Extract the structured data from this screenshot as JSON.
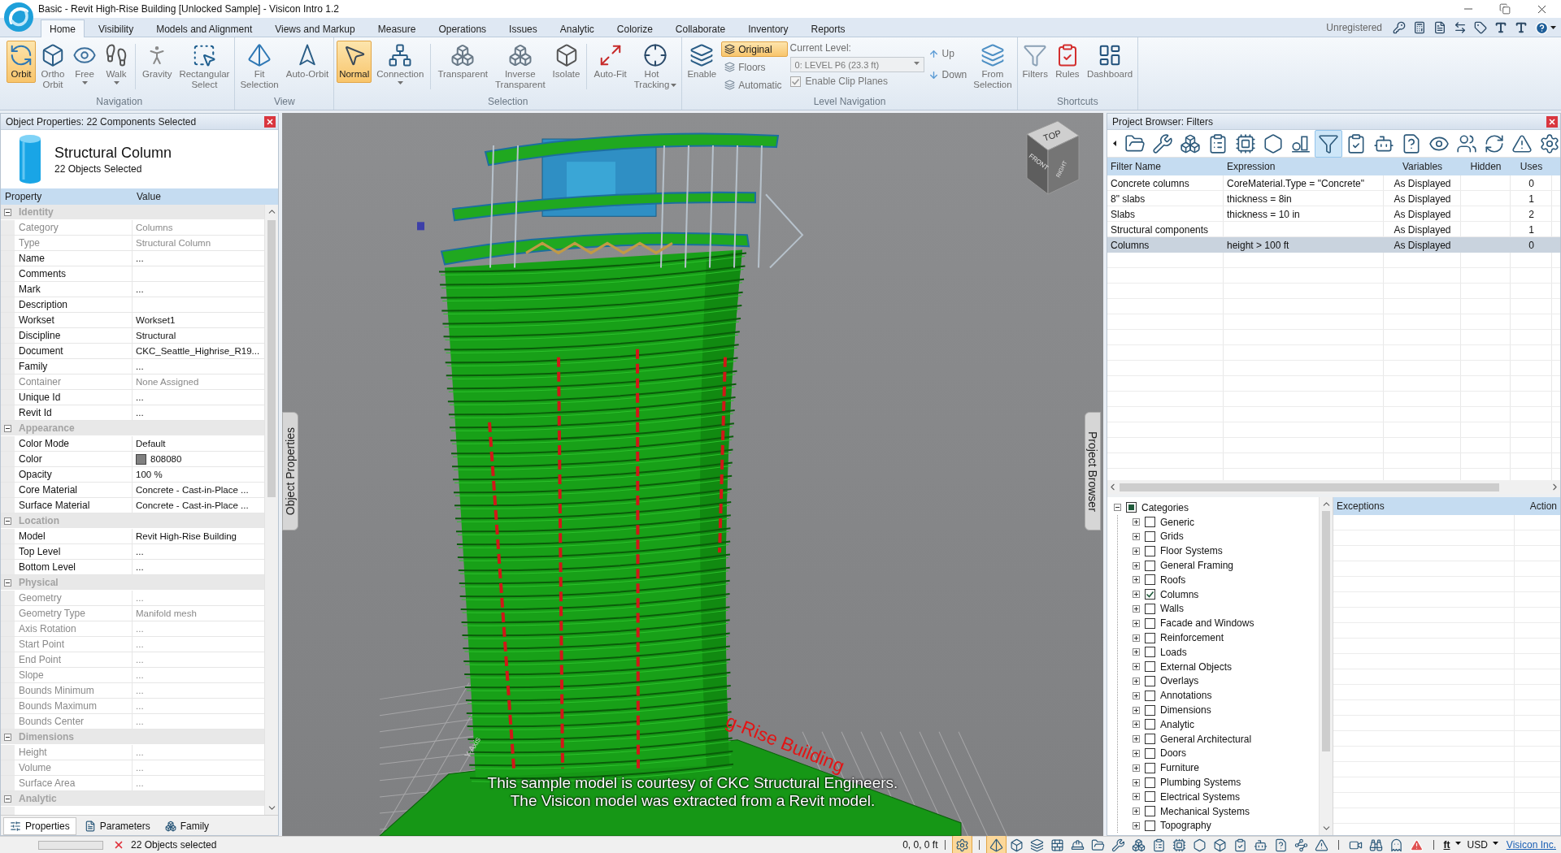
{
  "window": {
    "title": "Basic - Revit High-Rise Building [Unlocked Sample] - Visicon Intro 1.2"
  },
  "ribbon_tabs": [
    {
      "label": "Home",
      "selected": true
    },
    {
      "label": "Visibility",
      "selected": false
    },
    {
      "label": "Models and Alignment",
      "selected": false
    },
    {
      "label": "Views and Markup",
      "selected": false
    },
    {
      "label": "Measure",
      "selected": false
    },
    {
      "label": "Operations",
      "selected": false
    },
    {
      "label": "Issues",
      "selected": false
    },
    {
      "label": "Analytic",
      "selected": false
    },
    {
      "label": "Colorize",
      "selected": false
    },
    {
      "label": "Collaborate",
      "selected": false
    },
    {
      "label": "Inventory",
      "selected": false
    },
    {
      "label": "Reports",
      "selected": false
    }
  ],
  "account": {
    "status": "Unregistered"
  },
  "ribbon_groups": [
    {
      "label": "Navigation",
      "items": [
        {
          "kind": "large",
          "label": "Orbit",
          "selected": true,
          "dropdown": false
        },
        {
          "kind": "large",
          "label": "Ortho Orbit",
          "selected": false,
          "dropdown": false
        },
        {
          "kind": "large",
          "label": "Free",
          "selected": false,
          "dropdown": true
        },
        {
          "kind": "large",
          "label": "Walk",
          "selected": false,
          "dropdown": true
        },
        {
          "kind": "separator"
        },
        {
          "kind": "large",
          "label": "Gravity",
          "selected": false,
          "dropdown": false
        },
        {
          "kind": "large",
          "label": "Rectangular Select",
          "selected": false,
          "dropdown": false
        }
      ]
    },
    {
      "label": "View",
      "items": [
        {
          "kind": "large",
          "label": "Fit Selection",
          "selected": false,
          "dropdown": false
        },
        {
          "kind": "large",
          "label": "Auto-Orbit",
          "selected": false,
          "dropdown": false
        }
      ]
    },
    {
      "label": "Selection",
      "items": [
        {
          "kind": "large",
          "label": "Normal",
          "selected": true,
          "dropdown": false
        },
        {
          "kind": "large",
          "label": "Connection",
          "selected": false,
          "dropdown": true
        },
        {
          "kind": "separator"
        },
        {
          "kind": "large",
          "label": "Transparent",
          "selected": false,
          "dropdown": false
        },
        {
          "kind": "large",
          "label": "Inverse Transparent",
          "selected": false,
          "dropdown": false
        },
        {
          "kind": "large",
          "label": "Isolate",
          "selected": false,
          "dropdown": false
        },
        {
          "kind": "separator"
        },
        {
          "kind": "large",
          "label": "Auto-Fit",
          "selected": false,
          "dropdown": false
        },
        {
          "kind": "large",
          "label": "Hot Tracking",
          "selected": false,
          "dropdown": true
        }
      ]
    },
    {
      "label": "Level Navigation",
      "items": [
        {
          "kind": "large",
          "label": "Enable",
          "selected": false,
          "dropdown": false
        },
        {
          "kind": "mode_list",
          "options": [
            {
              "label": "Original",
              "selected": true
            },
            {
              "label": "Floors",
              "selected": false
            },
            {
              "label": "Automatic",
              "selected": false
            }
          ]
        },
        {
          "kind": "level_picker",
          "label": "Current Level:",
          "value": "0: LEVEL P6 (23.3 ft)",
          "disabled": true,
          "clip_planes": {
            "label": "Enable Clip Planes",
            "checked": true,
            "disabled": true
          }
        },
        {
          "kind": "step_list",
          "options": [
            {
              "label": "Up"
            },
            {
              "label": "Down"
            }
          ]
        },
        {
          "kind": "large",
          "label": "From Selection",
          "selected": false,
          "dropdown": false
        }
      ]
    },
    {
      "label": "Shortcuts",
      "items": [
        {
          "kind": "large",
          "label": "Filters",
          "selected": false,
          "dropdown": false
        },
        {
          "kind": "large",
          "label": "Rules",
          "selected": false,
          "dropdown": false
        },
        {
          "kind": "large",
          "label": "Dashboard",
          "selected": false,
          "dropdown": false
        }
      ]
    }
  ],
  "object_properties": {
    "title": "Object Properties: 22 Components Selected",
    "object_name": "Structural Column",
    "object_count": "22 Objects Selected",
    "columns": [
      "Property",
      "Value"
    ],
    "sections": [
      {
        "label": "Identity",
        "expanded": true,
        "rows": [
          {
            "property": "Category",
            "value": "Columns",
            "readonly": true
          },
          {
            "property": "Type",
            "value": "Structural Column",
            "readonly": true
          },
          {
            "property": "Name",
            "value": "...",
            "readonly": false
          },
          {
            "property": "Comments",
            "readonly": false
          },
          {
            "property": "Mark",
            "value": "...",
            "readonly": false
          },
          {
            "property": "Description",
            "readonly": false
          },
          {
            "property": "Workset",
            "value": "Workset1",
            "readonly": false
          },
          {
            "property": "Discipline",
            "value": "Structural",
            "readonly": false
          },
          {
            "property": "Document",
            "value": "CKC_Seattle_Highrise_R19...",
            "readonly": false
          },
          {
            "property": "Family",
            "value": "...",
            "readonly": false
          },
          {
            "property": "Container",
            "value": "None Assigned",
            "readonly": true
          },
          {
            "property": "Unique Id",
            "value": "...",
            "readonly": false
          },
          {
            "property": "Revit Id",
            "value": "...",
            "readonly": false
          }
        ]
      },
      {
        "label": "Appearance",
        "expanded": true,
        "rows": [
          {
            "property": "Color Mode",
            "value": "Default",
            "readonly": false
          },
          {
            "property": "Color",
            "value": "808080",
            "color": "#808080",
            "readonly": false
          },
          {
            "property": "Opacity",
            "value": "100 %",
            "readonly": false
          },
          {
            "property": "Core Material",
            "value": "Concrete - Cast-in-Place ...",
            "readonly": false
          },
          {
            "property": "Surface Material",
            "value": "Concrete - Cast-in-Place ...",
            "readonly": false
          }
        ]
      },
      {
        "label": "Location",
        "expanded": true,
        "rows": [
          {
            "property": "Model",
            "value": "Revit High-Rise Building",
            "readonly": false
          },
          {
            "property": "Top Level",
            "value": "...",
            "readonly": false
          },
          {
            "property": "Bottom Level",
            "value": "...",
            "readonly": false
          }
        ]
      },
      {
        "label": "Physical",
        "expanded": true,
        "rows": [
          {
            "property": "Geometry",
            "value": "...",
            "readonly": true
          },
          {
            "property": "Geometry Type",
            "value": "Manifold mesh",
            "readonly": true
          },
          {
            "property": "Axis Rotation",
            "value": "...",
            "readonly": true
          },
          {
            "property": "Start Point",
            "value": "...",
            "readonly": true
          },
          {
            "property": "End Point",
            "value": "...",
            "readonly": true
          },
          {
            "property": "Slope",
            "value": "...",
            "readonly": true
          },
          {
            "property": "Bounds Minimum",
            "value": "...",
            "readonly": true
          },
          {
            "property": "Bounds Maximum",
            "value": "...",
            "readonly": true
          },
          {
            "property": "Bounds Center",
            "value": "...",
            "readonly": true
          }
        ]
      },
      {
        "label": "Dimensions",
        "expanded": true,
        "rows": [
          {
            "property": "Height",
            "value": "...",
            "readonly": true
          },
          {
            "property": "Volume",
            "value": "...",
            "readonly": true
          },
          {
            "property": "Surface Area",
            "value": "...",
            "readonly": true
          }
        ]
      },
      {
        "label": "Analytic",
        "expanded": true
      }
    ],
    "tabs": [
      {
        "label": "Properties",
        "selected": true
      },
      {
        "label": "Parameters",
        "selected": false
      },
      {
        "label": "Family",
        "selected": false
      }
    ]
  },
  "viewport": {
    "view_cube": {
      "faces": [
        "TOP",
        "FRONT",
        "RIGHT"
      ]
    },
    "model_label": "g-Rise Building",
    "axis_label": "Y-Axis",
    "caption": [
      "This sample model is courtesy of CKC Structural Engineers.",
      "The Visicon model was extracted from a Revit model."
    ],
    "dock_tabs": [
      {
        "label": "Object Properties"
      },
      {
        "label": "Project Browser"
      }
    ]
  },
  "project_browser": {
    "title": "Project Browser: Filters",
    "toolbar": [
      {
        "selected": false
      },
      {
        "selected": false
      },
      {
        "selected": false
      },
      {
        "selected": false
      },
      {
        "selected": false
      },
      {
        "selected": false
      },
      {
        "selected": false
      },
      {
        "selected": true
      },
      {
        "selected": false
      },
      {
        "selected": false
      },
      {
        "selected": false
      },
      {
        "selected": false
      },
      {
        "selected": false
      },
      {
        "selected": false
      },
      {
        "selected": false
      },
      {
        "selected": false
      }
    ],
    "filters": {
      "columns": [
        "Filter Name",
        "Expression",
        "Variables",
        "Hidden",
        "Uses"
      ],
      "rows": [
        {
          "name": "Concrete columns",
          "expression": "CoreMaterial.Type = \"Concrete\"",
          "variables": "As Displayed",
          "uses": "0",
          "selected": false
        },
        {
          "name": "8\" slabs",
          "expression": "thickness = 8in",
          "variables": "As Displayed",
          "uses": "1",
          "selected": false
        },
        {
          "name": "Slabs",
          "expression": "thickness = 10 in",
          "variables": "As Displayed",
          "uses": "2",
          "selected": false
        },
        {
          "name": "Structural components",
          "variables": "As Displayed",
          "uses": "1",
          "selected": false
        },
        {
          "name": "Columns",
          "expression": "height > 100 ft",
          "variables": "As Displayed",
          "uses": "0",
          "selected": true
        }
      ]
    },
    "categories": {
      "label": "Categories",
      "expanded": true,
      "checked": false,
      "indeterminate": true,
      "children": [
        {
          "label": "Generic",
          "expanded": false,
          "checked": false
        },
        {
          "label": "Grids",
          "expanded": false,
          "checked": false
        },
        {
          "label": "Floor Systems",
          "expanded": false,
          "checked": false
        },
        {
          "label": "General Framing",
          "expanded": false,
          "checked": false
        },
        {
          "label": "Roofs",
          "expanded": false,
          "checked": false
        },
        {
          "label": "Columns",
          "expanded": false,
          "checked": true
        },
        {
          "label": "Walls",
          "expanded": false,
          "checked": false
        },
        {
          "label": "Facade and Windows",
          "expanded": false,
          "checked": false
        },
        {
          "label": "Reinforcement",
          "expanded": false,
          "checked": false
        },
        {
          "label": "Loads",
          "expanded": false,
          "checked": false
        },
        {
          "label": "External Objects",
          "expanded": false,
          "checked": false
        },
        {
          "label": "Overlays",
          "expanded": false,
          "checked": false
        },
        {
          "label": "Annotations",
          "expanded": false,
          "checked": false
        },
        {
          "label": "Dimensions",
          "expanded": false,
          "checked": false
        },
        {
          "label": "Analytic",
          "expanded": false,
          "checked": false
        },
        {
          "label": "General Architectural",
          "expanded": false,
          "checked": false
        },
        {
          "label": "Doors",
          "expanded": false,
          "checked": false
        },
        {
          "label": "Furniture",
          "expanded": false,
          "checked": false
        },
        {
          "label": "Plumbing Systems",
          "expanded": false,
          "checked": false
        },
        {
          "label": "Electrical Systems",
          "expanded": false,
          "checked": false
        },
        {
          "label": "Mechanical Systems",
          "expanded": false,
          "checked": false
        },
        {
          "label": "Topography",
          "expanded": false,
          "checked": false
        }
      ]
    },
    "exceptions": {
      "columns": [
        "Exceptions",
        "Action"
      ]
    }
  },
  "status_bar": {
    "progress": {
      "level": 0
    },
    "selection_text": "22 Objects selected",
    "coordinates": "0, 0, 0 ft",
    "tool_groups": [
      [
        {
          "selected": true
        }
      ],
      [
        {
          "selected": true
        },
        {
          "selected": false
        },
        {
          "selected": false
        },
        {
          "selected": false
        },
        {
          "selected": false
        },
        {
          "selected": false
        },
        {
          "selected": false
        },
        {
          "selected": false
        },
        {
          "selected": false
        },
        {
          "selected": false
        },
        {
          "selected": false
        },
        {
          "selected": false
        },
        {
          "selected": false
        },
        {
          "selected": false
        },
        {
          "selected": false
        },
        {
          "selected": false
        },
        {
          "selected": false
        }
      ],
      [
        {
          "selected": false
        },
        {
          "selected": false
        },
        {
          "selected": false
        },
        {
          "selected": false
        }
      ]
    ],
    "unit": "ft",
    "currency": "USD",
    "link": "Visicon Inc."
  }
}
